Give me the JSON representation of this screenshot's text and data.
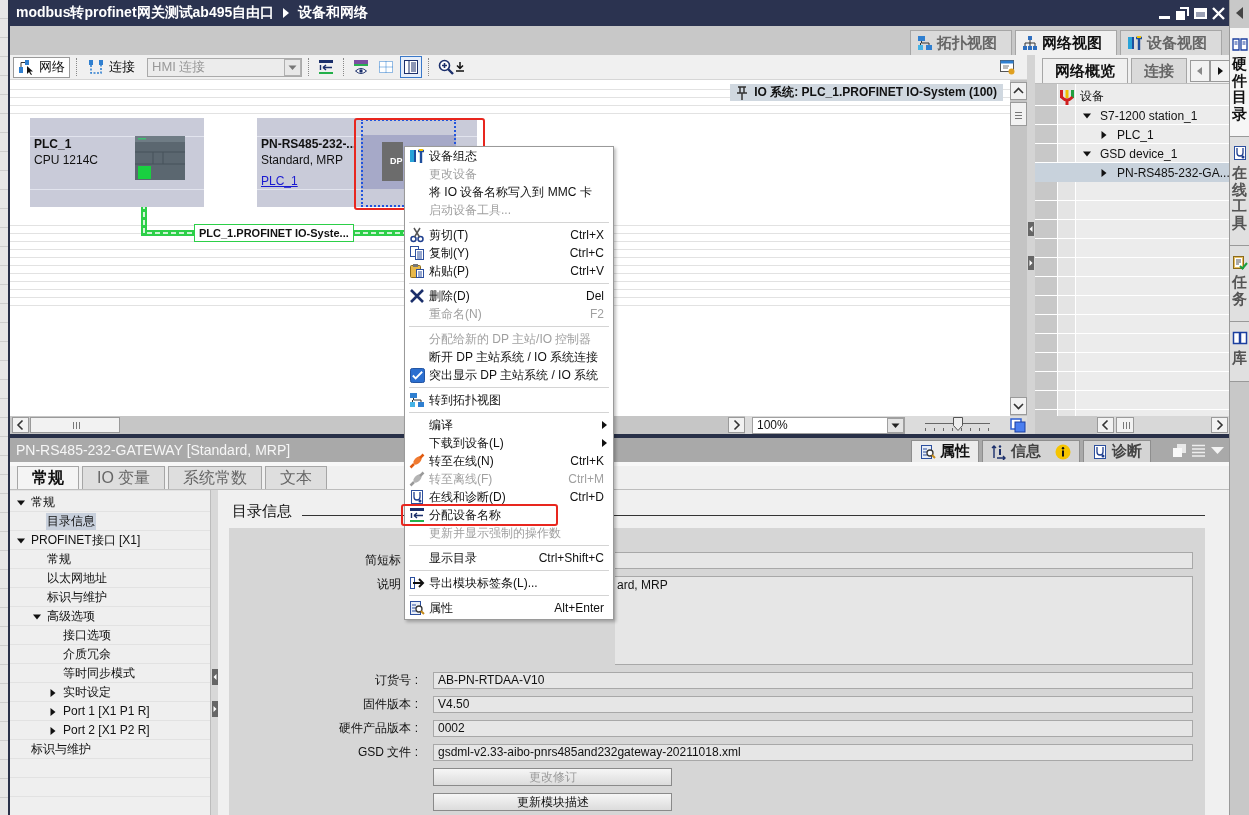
{
  "window": {
    "title_path": [
      "modbus转profinet网关测试ab495自由口",
      "设备和网络"
    ]
  },
  "side_tabs": [
    {
      "label": "硬件目录",
      "selected": true
    },
    {
      "label": "在线工具",
      "selected": false
    },
    {
      "label": "任务",
      "selected": false
    },
    {
      "label": "库",
      "selected": false
    }
  ],
  "view_tabs": [
    {
      "label": "拓扑视图",
      "selected": false
    },
    {
      "label": "网络视图",
      "selected": true
    },
    {
      "label": "设备视图",
      "selected": false
    }
  ],
  "toolbar": {
    "modes": [
      {
        "label": "网络",
        "on": true
      },
      {
        "label": "连接",
        "on": false
      }
    ],
    "connection_type": {
      "value": "HMI 连接",
      "disabled": true
    },
    "tools": [
      {
        "on": false
      },
      {
        "on": false
      },
      {
        "on": false
      },
      {
        "on": true
      },
      {
        "on": false
      }
    ]
  },
  "canvas": {
    "io_system": "IO 系统: PLC_1.PROFINET IO-System (100)",
    "devices": [
      {
        "kind": "plc",
        "name": "PLC_1",
        "type": "CPU 1214C",
        "selected": false,
        "marked": false
      },
      {
        "kind": "io_device",
        "name": "PN-RS485-232-...",
        "type": "Standard, MRP",
        "controller_link": "PLC_1",
        "module_label": "DP",
        "selected": true,
        "marked": true
      }
    ],
    "network": {
      "label": "PLC_1.PROFINET IO-Syste...",
      "highlighted": true
    }
  },
  "zoom": {
    "value": "100%",
    "level": 0.5
  },
  "overview": {
    "tabs": [
      {
        "label": "网络概览",
        "selected": true
      },
      {
        "label": "连接",
        "selected": false
      }
    ],
    "column": "设备",
    "tree": [
      {
        "label": "S7-1200 station_1",
        "expanded": true,
        "selected": false,
        "children": [
          {
            "label": "PLC_1",
            "expanded": false,
            "selected": false
          }
        ]
      },
      {
        "label": "GSD device_1",
        "expanded": true,
        "selected": false,
        "children": [
          {
            "label": "PN-RS485-232-GA...",
            "expanded": false,
            "selected": true
          }
        ]
      }
    ]
  },
  "inspector": {
    "title": "PN-RS485-232-GATEWAY [Standard, MRP]",
    "panel_tabs": [
      {
        "label": "属性",
        "selected": true
      },
      {
        "label": "信息",
        "selected": false
      },
      {
        "label": "诊断",
        "selected": false
      }
    ],
    "tabs": [
      {
        "label": "常规",
        "selected": true
      },
      {
        "label": "IO 变量",
        "selected": false
      },
      {
        "label": "系统常数",
        "selected": false
      },
      {
        "label": "文本",
        "selected": false
      }
    ],
    "nav": [
      {
        "label": "常规",
        "expanded": true,
        "selected": false,
        "children": [
          {
            "label": "目录信息",
            "selected": true
          }
        ]
      },
      {
        "label": "PROFINET接口 [X1]",
        "expanded": true,
        "selected": false,
        "children": [
          {
            "label": "常规",
            "selected": false
          },
          {
            "label": "以太网地址",
            "selected": false
          },
          {
            "label": "标识与维护",
            "selected": false
          },
          {
            "label": "高级选项",
            "expanded": true,
            "selected": false,
            "children": [
              {
                "label": "接口选项",
                "selected": false
              },
              {
                "label": "介质冗余",
                "selected": false
              },
              {
                "label": "等时同步模式",
                "selected": false
              },
              {
                "label": "实时设定",
                "expanded": false,
                "selected": false
              },
              {
                "label": "Port 1 [X1 P1 R]",
                "expanded": false,
                "selected": false
              },
              {
                "label": "Port 2 [X1 P2 R]",
                "expanded": false,
                "selected": false
              }
            ]
          }
        ]
      },
      {
        "label": "标识与维护",
        "selected": false
      }
    ],
    "section": "目录信息",
    "fields": [
      {
        "kind": "line",
        "label": "简短标",
        "covered": true
      },
      {
        "kind": "multiline",
        "label": "说明",
        "value": "ard, MRP",
        "covered": true
      },
      {
        "kind": "line",
        "label": "订货号 :",
        "value": "AB-PN-RTDAA-V10",
        "covered": false
      },
      {
        "kind": "line",
        "label": "固件版本 :",
        "value": "V4.50",
        "covered": false
      },
      {
        "kind": "line",
        "label": "硬件产品版本 :",
        "value": "0002",
        "covered": false
      },
      {
        "kind": "line",
        "label": "GSD 文件 :",
        "value": "gsdml-v2.33-aibo-pnrs485and232gateway-20211018.xml",
        "covered": false
      }
    ],
    "buttons": [
      {
        "label": "更改修订",
        "disabled": true
      },
      {
        "label": "更新模块描述",
        "disabled": false
      }
    ]
  },
  "context_menu": {
    "items": [
      {
        "kind": "command",
        "label": "设备组态",
        "disabled": false,
        "marked": false
      },
      {
        "kind": "command",
        "label": "更改设备",
        "disabled": true,
        "marked": false
      },
      {
        "kind": "command",
        "label": "将 IO 设备名称写入到 MMC 卡",
        "disabled": false,
        "marked": false
      },
      {
        "kind": "command",
        "label": "启动设备工具...",
        "disabled": true,
        "marked": false
      },
      {
        "kind": "separator"
      },
      {
        "kind": "command",
        "label": "剪切(T)",
        "shortcut": "Ctrl+X",
        "disabled": false,
        "marked": false
      },
      {
        "kind": "command",
        "label": "复制(Y)",
        "shortcut": "Ctrl+C",
        "disabled": false,
        "marked": false
      },
      {
        "kind": "command",
        "label": "粘贴(P)",
        "shortcut": "Ctrl+V",
        "disabled": false,
        "marked": false
      },
      {
        "kind": "separator"
      },
      {
        "kind": "command",
        "label": "删除(D)",
        "shortcut": "Del",
        "disabled": false,
        "marked": false
      },
      {
        "kind": "command",
        "label": "重命名(N)",
        "shortcut": "F2",
        "disabled": true,
        "marked": false
      },
      {
        "kind": "separator"
      },
      {
        "kind": "command",
        "label": "分配给新的 DP 主站/IO 控制器",
        "disabled": true,
        "marked": false
      },
      {
        "kind": "command",
        "label": "断开 DP 主站系统 / IO 系统连接",
        "disabled": false,
        "marked": false
      },
      {
        "kind": "check",
        "label": "突出显示 DP 主站系统 / IO 系统",
        "checked": true,
        "disabled": false,
        "marked": false
      },
      {
        "kind": "separator"
      },
      {
        "kind": "command",
        "label": "转到拓扑视图",
        "disabled": false,
        "marked": false
      },
      {
        "kind": "separator"
      },
      {
        "kind": "submenu",
        "label": "编译",
        "disabled": false,
        "marked": false
      },
      {
        "kind": "submenu",
        "label": "下载到设备(L)",
        "disabled": false,
        "marked": false
      },
      {
        "kind": "command",
        "label": "转至在线(N)",
        "shortcut": "Ctrl+K",
        "disabled": false,
        "marked": false
      },
      {
        "kind": "command",
        "label": "转至离线(F)",
        "shortcut": "Ctrl+M",
        "disabled": true,
        "marked": false
      },
      {
        "kind": "command",
        "label": "在线和诊断(D)",
        "shortcut": "Ctrl+D",
        "disabled": false,
        "marked": false
      },
      {
        "kind": "command",
        "label": "分配设备名称",
        "disabled": false,
        "marked": true
      },
      {
        "kind": "command",
        "label": "更新并显示强制的操作数",
        "disabled": true,
        "marked": false
      },
      {
        "kind": "separator"
      },
      {
        "kind": "command",
        "label": "显示目录",
        "shortcut": "Ctrl+Shift+C",
        "disabled": false,
        "marked": false
      },
      {
        "kind": "separator"
      },
      {
        "kind": "command",
        "label": "导出模块标签条(L)...",
        "disabled": false,
        "marked": false
      },
      {
        "kind": "separator"
      },
      {
        "kind": "command",
        "label": "属性",
        "shortcut": "Alt+Enter",
        "disabled": false,
        "marked": false
      }
    ]
  }
}
